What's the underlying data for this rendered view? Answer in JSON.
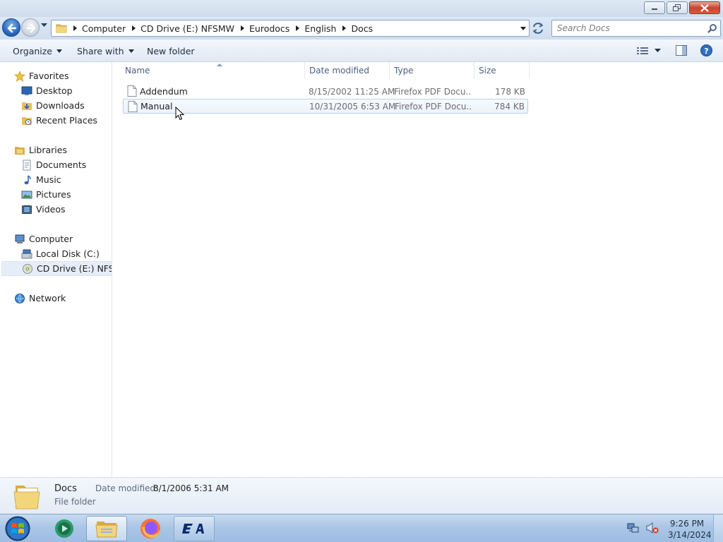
{
  "window": {
    "controls": [
      {
        "name": "minimize-button",
        "icon": "minimize-icon"
      },
      {
        "name": "restore-button",
        "icon": "restore-icon"
      },
      {
        "name": "close-button",
        "icon": "close-icon"
      }
    ]
  },
  "address": {
    "breadcrumbs": [
      "Computer",
      "CD Drive (E:) NFSMW",
      "Eurodocs",
      "English",
      "Docs"
    ],
    "search_placeholder": "Search Docs"
  },
  "toolbar": {
    "organize": "Organize",
    "share_with": "Share with",
    "new_folder": "New folder"
  },
  "navigation": {
    "favorites": {
      "label": "Favorites",
      "items": [
        "Desktop",
        "Downloads",
        "Recent Places"
      ]
    },
    "libraries": {
      "label": "Libraries",
      "items": [
        "Documents",
        "Music",
        "Pictures",
        "Videos"
      ]
    },
    "computer": {
      "label": "Computer",
      "items": [
        "Local Disk (C:)",
        "CD Drive (E:) NFSMW"
      ],
      "selected": "CD Drive (E:) NFSMW"
    },
    "network": {
      "label": "Network"
    }
  },
  "columns": {
    "name": "Name",
    "date": "Date modified",
    "type": "Type",
    "size": "Size"
  },
  "files": [
    {
      "name": "Addendum",
      "date": "8/15/2002 11:25 AM",
      "type": "Firefox PDF Docu...",
      "size": "178 KB"
    },
    {
      "name": "Manual",
      "date": "10/31/2005 6:53 AM",
      "type": "Firefox PDF Docu...",
      "size": "784 KB"
    }
  ],
  "details": {
    "name": "Docs",
    "type": "File folder",
    "date_label": "Date modified:",
    "date_value": "8/1/2006 5:31 AM"
  },
  "taskbar": {
    "time": "9:26 PM",
    "date": "3/14/2024",
    "apps": [
      "start-orb",
      "windows-media-center",
      "windows-explorer",
      "firefox",
      "ea-app"
    ]
  },
  "colors": {
    "accent": "#1f5fb4",
    "selection": "#e5eef8",
    "header_text": "#4d6185"
  }
}
